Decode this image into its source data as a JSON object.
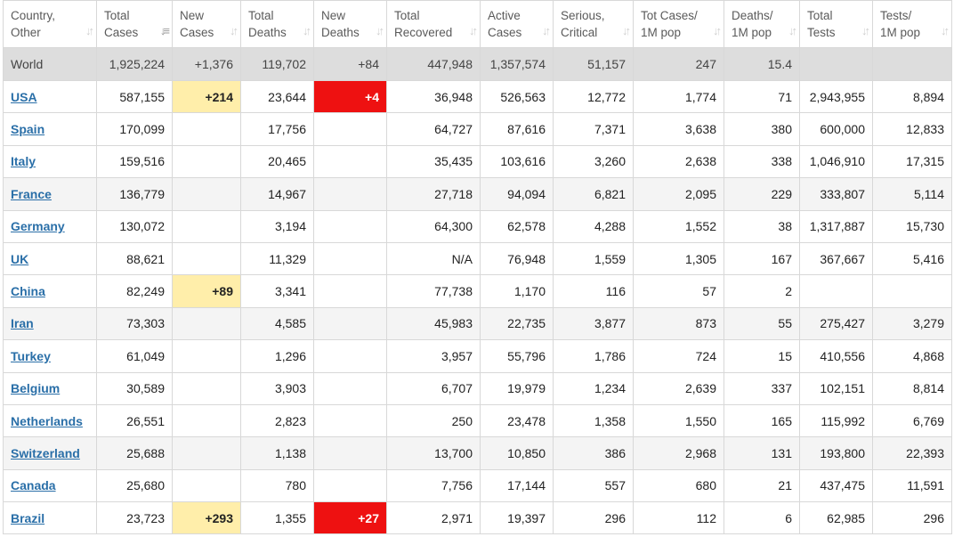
{
  "table": {
    "columns": [
      {
        "line1": "Country,",
        "line2": "Other",
        "sort_icon": "sort-icon",
        "active": false
      },
      {
        "line1": "Total",
        "line2": "Cases",
        "sort_icon": "sort-desc-icon",
        "active": true
      },
      {
        "line1": "New",
        "line2": "Cases",
        "sort_icon": "sort-icon",
        "active": false
      },
      {
        "line1": "Total",
        "line2": "Deaths",
        "sort_icon": "sort-icon",
        "active": false
      },
      {
        "line1": "New",
        "line2": "Deaths",
        "sort_icon": "sort-icon",
        "active": false
      },
      {
        "line1": "Total",
        "line2": "Recovered",
        "sort_icon": "sort-icon",
        "active": false
      },
      {
        "line1": "Active",
        "line2": "Cases",
        "sort_icon": "sort-icon",
        "active": false
      },
      {
        "line1": "Serious,",
        "line2": "Critical",
        "sort_icon": "sort-icon",
        "active": false
      },
      {
        "line1": "Tot Cases/",
        "line2": "1M pop",
        "sort_icon": "sort-icon",
        "active": false
      },
      {
        "line1": "Deaths/",
        "line2": "1M pop",
        "sort_icon": "sort-icon",
        "active": false
      },
      {
        "line1": "Total",
        "line2": "Tests",
        "sort_icon": "sort-icon",
        "active": false
      },
      {
        "line1": "Tests/",
        "line2": "1M pop",
        "sort_icon": "sort-icon",
        "active": false
      }
    ],
    "world": [
      "World",
      "1,925,224",
      "+1,376",
      "119,702",
      "+84",
      "447,948",
      "1,357,574",
      "51,157",
      "247",
      "15.4",
      "",
      ""
    ],
    "rows": [
      [
        "USA",
        "587,155",
        "+214",
        "23,644",
        "+4",
        "36,948",
        "526,563",
        "12,772",
        "1,774",
        "71",
        "2,943,955",
        "8,894"
      ],
      [
        "Spain",
        "170,099",
        "",
        "17,756",
        "",
        "64,727",
        "87,616",
        "7,371",
        "3,638",
        "380",
        "600,000",
        "12,833"
      ],
      [
        "Italy",
        "159,516",
        "",
        "20,465",
        "",
        "35,435",
        "103,616",
        "3,260",
        "2,638",
        "338",
        "1,046,910",
        "17,315"
      ],
      [
        "France",
        "136,779",
        "",
        "14,967",
        "",
        "27,718",
        "94,094",
        "6,821",
        "2,095",
        "229",
        "333,807",
        "5,114"
      ],
      [
        "Germany",
        "130,072",
        "",
        "3,194",
        "",
        "64,300",
        "62,578",
        "4,288",
        "1,552",
        "38",
        "1,317,887",
        "15,730"
      ],
      [
        "UK",
        "88,621",
        "",
        "11,329",
        "",
        "N/A",
        "76,948",
        "1,559",
        "1,305",
        "167",
        "367,667",
        "5,416"
      ],
      [
        "China",
        "82,249",
        "+89",
        "3,341",
        "",
        "77,738",
        "1,170",
        "116",
        "57",
        "2",
        "",
        ""
      ],
      [
        "Iran",
        "73,303",
        "",
        "4,585",
        "",
        "45,983",
        "22,735",
        "3,877",
        "873",
        "55",
        "275,427",
        "3,279"
      ],
      [
        "Turkey",
        "61,049",
        "",
        "1,296",
        "",
        "3,957",
        "55,796",
        "1,786",
        "724",
        "15",
        "410,556",
        "4,868"
      ],
      [
        "Belgium",
        "30,589",
        "",
        "3,903",
        "",
        "6,707",
        "19,979",
        "1,234",
        "2,639",
        "337",
        "102,151",
        "8,814"
      ],
      [
        "Netherlands",
        "26,551",
        "",
        "2,823",
        "",
        "250",
        "23,478",
        "1,358",
        "1,550",
        "165",
        "115,992",
        "6,769"
      ],
      [
        "Switzerland",
        "25,688",
        "",
        "1,138",
        "",
        "13,700",
        "10,850",
        "386",
        "2,968",
        "131",
        "193,800",
        "22,393"
      ],
      [
        "Canada",
        "25,680",
        "",
        "780",
        "",
        "7,756",
        "17,144",
        "557",
        "680",
        "21",
        "437,475",
        "11,591"
      ],
      [
        "Brazil",
        "23,723",
        "+293",
        "1,355",
        "+27",
        "2,971",
        "19,397",
        "296",
        "112",
        "6",
        "62,985",
        "296"
      ]
    ],
    "colors": {
      "new_cases_highlight": "#ffeeaa",
      "new_deaths_highlight": "#ee1111",
      "link": "#2a6fa8",
      "world_row": "#dddddd"
    }
  }
}
